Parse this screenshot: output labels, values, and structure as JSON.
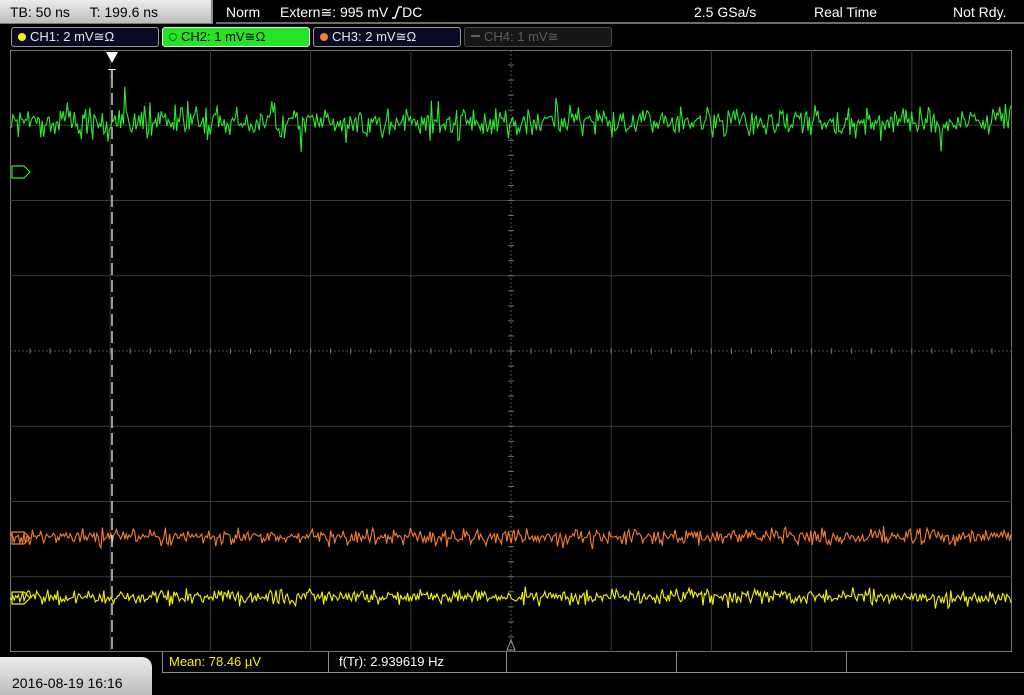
{
  "status": {
    "timebase": "TB: 50 ns",
    "trigger_time": "T: 199.6 ns",
    "mode": "Norm",
    "trigger_source": "Extern≅: 995 mV",
    "trigger_coupling": "DC",
    "sample_rate": "2.5 GSa/s",
    "acquisition": "Real Time",
    "state": "Not Rdy."
  },
  "channels": [
    {
      "label": "CH1: 2 mV≅Ω",
      "color": "#f4f400",
      "active": false,
      "enabled": true
    },
    {
      "label": "CH2: 1 mV≅Ω",
      "color": "#2ee82e",
      "active": true,
      "enabled": true
    },
    {
      "label": "CH3: 2 mV≅Ω",
      "color": "#f57e2a",
      "active": false,
      "enabled": true
    },
    {
      "label": "CH4: 1 mV≅",
      "color": "#5e5e5e",
      "active": false,
      "enabled": false
    }
  ],
  "trigger_marker": "T",
  "trace_colors": {
    "ch1": "#f4f400",
    "ch2": "#2ee82e",
    "ch3": "#f57e2a"
  },
  "footer": {
    "datetime": "2016-08-19 16:16",
    "measurements": [
      {
        "label": "Mean: 78.46 µV",
        "color": "#f4f400"
      },
      {
        "label": "f(Tr): 2.939619 Hz",
        "color": "#ffffff"
      }
    ]
  }
}
